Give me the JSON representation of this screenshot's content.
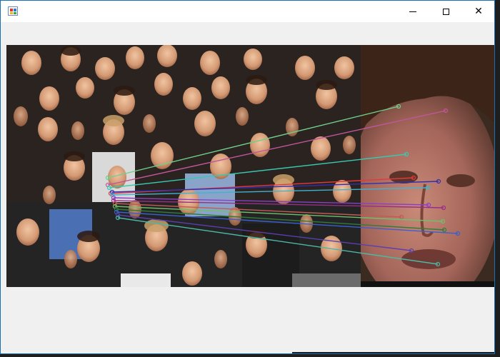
{
  "window": {
    "title": "",
    "icon": "app-icon",
    "controls": {
      "minimize": "minimize-icon",
      "maximize": "maximize-icon",
      "close": "close-icon",
      "close_glyph": "✕"
    }
  },
  "image": {
    "left_panel": "crowd-photo",
    "right_panel": "face-closeup-photo",
    "match_colors": [
      "#6fd08c",
      "#c2569b",
      "#38c8b0",
      "#e23a3a",
      "#2f2fb5",
      "#3fb3d0",
      "#8b3fc4",
      "#9a2c8a",
      "#c25a56",
      "#6fbf6a",
      "#2e7d3a",
      "#3a5fd0",
      "#5a3fb0",
      "#4cb8a6"
    ]
  }
}
